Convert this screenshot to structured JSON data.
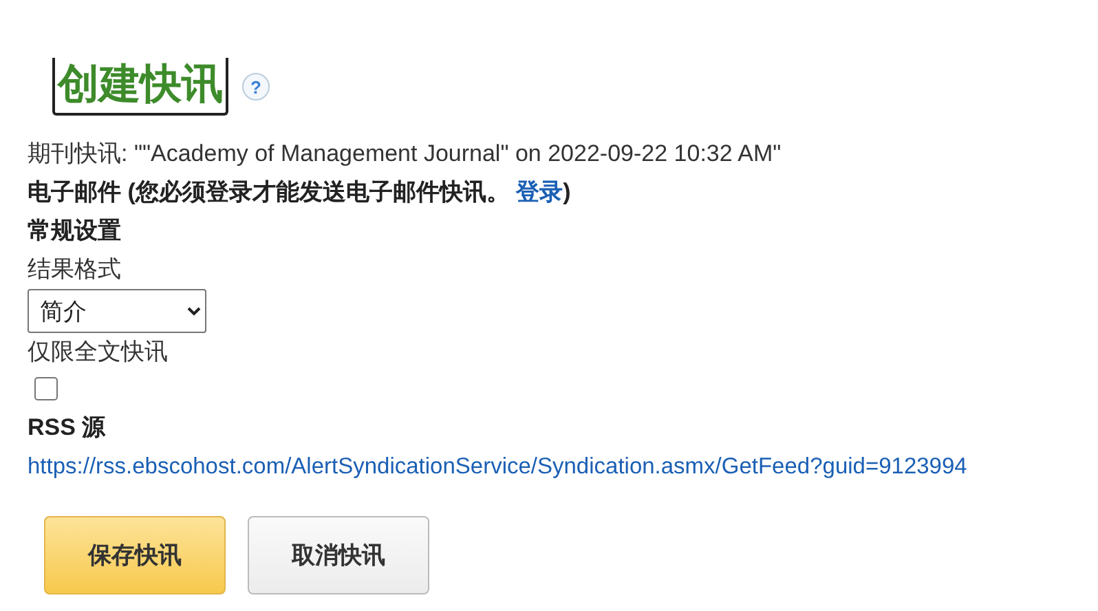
{
  "title": "创建快讯",
  "help_icon": "?",
  "journal_alert": "期刊快讯: \"\"Academy of Management Journal\" on 2022-09-22 10:32 AM\"",
  "email": {
    "before": "电子邮件 (您必须登录才能发送电子邮件快讯。 ",
    "link": "登录",
    "after": ")"
  },
  "general_settings": {
    "heading": "常规设置",
    "format_label": "结果格式",
    "format_value": "简介",
    "fulltext_label": "仅限全文快讯",
    "fulltext_checked": false
  },
  "rss": {
    "heading": "RSS 源",
    "url": "https://rss.ebscohost.com/AlertSyndicationService/Syndication.asmx/GetFeed?guid=9123994"
  },
  "buttons": [
    {
      "label": "保存快讯",
      "kind": "primary"
    },
    {
      "label": "取消快讯",
      "kind": "secondary"
    }
  ]
}
